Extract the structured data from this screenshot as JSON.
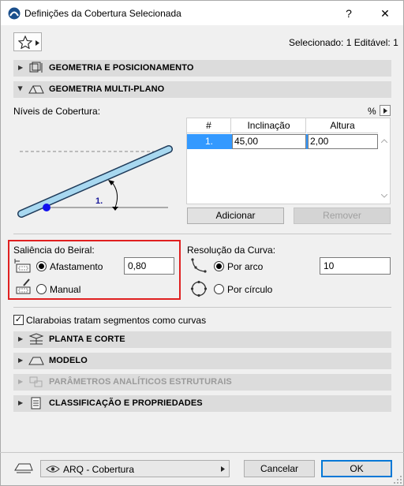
{
  "window": {
    "title": "Definições da Cobertura Selecionada",
    "help_glyph": "?",
    "close_glyph": "✕"
  },
  "header": {
    "selection_info": "Selecionado: 1 Editável: 1"
  },
  "sections": {
    "geometry_positioning": "GEOMETRIA E POSICIONAMENTO",
    "multiplane_geometry": "GEOMETRIA MULTI-PLANO",
    "plan_section": "PLANTA E CORTE",
    "model": "MODELO",
    "structural": "PARÂMETROS ANALÍTICOS ESTRUTURAIS",
    "classification": "CLASSIFICAÇÃO E PROPRIEDADES"
  },
  "levels": {
    "label": "Níveis de Cobertura:",
    "percent_label": "%",
    "diagram_label": "1.",
    "columns": [
      "#",
      "Inclinação",
      "Altura"
    ],
    "rows": [
      {
        "num": "1.",
        "slope": "45,00",
        "height": "2,00"
      }
    ],
    "add_label": "Adicionar",
    "remove_label": "Remover"
  },
  "eave": {
    "label": "Saliência do Beiral:",
    "offset_label": "Afastamento",
    "offset_value": "0,80",
    "manual_label": "Manual",
    "offset_selected": true
  },
  "curve": {
    "label": "Resolução da Curva:",
    "by_arc_label": "Por arco",
    "by_arc_value": "10",
    "by_circle_label": "Por círculo",
    "by_arc_selected": true
  },
  "skylights": {
    "label": "Claraboias tratam segmentos como curvas",
    "checked": true
  },
  "footer": {
    "layer_value": "ARQ - Cobertura",
    "cancel_label": "Cancelar",
    "ok_label": "OK"
  },
  "colors": {
    "selection_row": "#3399ff",
    "eave_highlight": "#e02020",
    "roof_beam": "#a8d8f0",
    "pivot_dot": "#1010ee"
  }
}
